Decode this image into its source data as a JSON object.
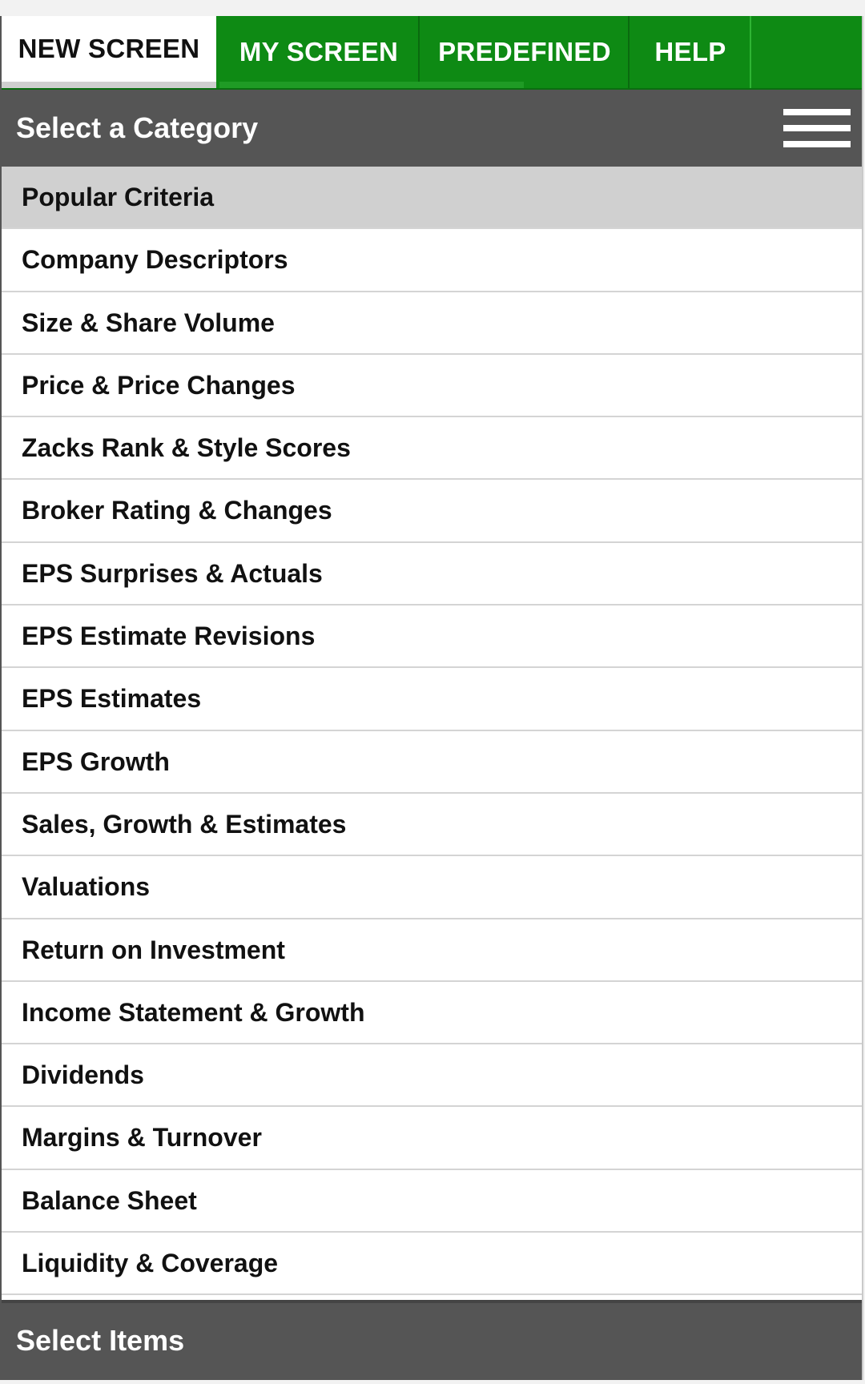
{
  "tabs": {
    "new_screen": "NEW SCREEN",
    "my_screen": "MY SCREEN",
    "predefined": "PREDEFINED",
    "help": "HELP",
    "active": "NEW SCREEN"
  },
  "category_header": {
    "title": "Select a Category",
    "menu_icon": "hamburger-menu-icon"
  },
  "categories": [
    "Popular Criteria",
    "Company Descriptors",
    "Size & Share Volume",
    "Price & Price Changes",
    "Zacks Rank & Style Scores",
    "Broker Rating & Changes",
    "EPS Surprises & Actuals",
    "EPS Estimate Revisions",
    "EPS Estimates",
    "EPS Growth",
    "Sales, Growth & Estimates",
    "Valuations",
    "Return on Investment",
    "Income Statement & Growth",
    "Dividends",
    "Margins & Turnover",
    "Balance Sheet",
    "Liquidity & Coverage"
  ],
  "selected_category": "Popular Criteria",
  "items_header": {
    "title": "Select Items"
  },
  "colors": {
    "tab_green": "#0e8a14",
    "header_gray": "#555555",
    "selected_row": "#d0d0d0"
  }
}
